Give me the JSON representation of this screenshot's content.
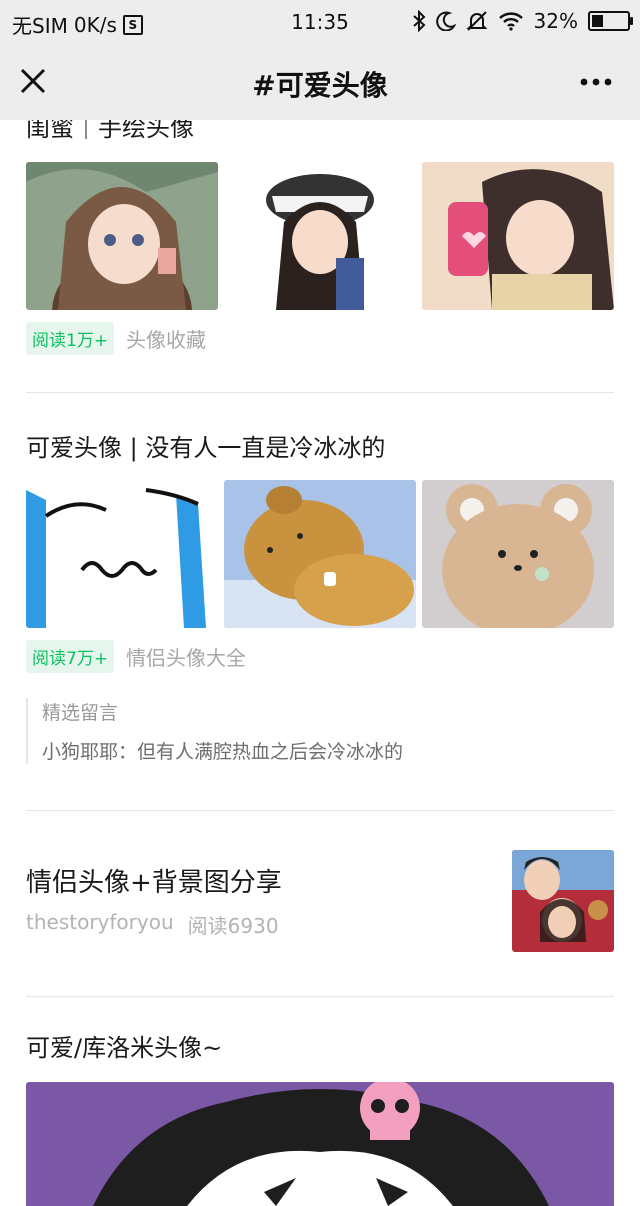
{
  "status_bar": {
    "carrier": "无SIM",
    "speed": "0K/s",
    "sim_icon_letter": "S",
    "time": "11:35",
    "battery": "32%",
    "battery_level": 0.32
  },
  "nav": {
    "title": "#可爱头像"
  },
  "articles": [
    {
      "title": "闺蜜｜手绘头像",
      "read": "阅读1万+",
      "source": "头像收藏"
    },
    {
      "title": "可爱头像 | 没有人一直是冷冰冰的",
      "read": "阅读7万+",
      "source": "情侣头像大全",
      "comments": {
        "header": "精选留言",
        "text": "小狗耶耶：但有人满腔热血之后会冷冰冰的"
      }
    },
    {
      "title": "情侣头像+背景图分享",
      "author": "thestoryforyou",
      "read": "阅读6930"
    },
    {
      "title": "可爱/库洛米头像~"
    }
  ],
  "colors": {
    "accent_green": "#07c160",
    "nav_bg": "#ededed"
  }
}
